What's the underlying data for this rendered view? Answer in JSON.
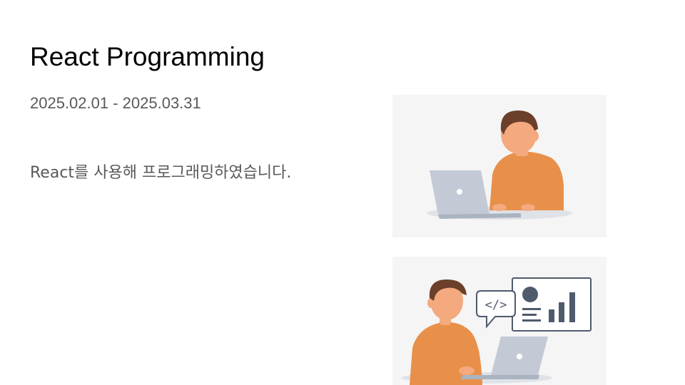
{
  "slide": {
    "title": "React Programming",
    "date_range": "2025.02.01 - 2025.03.31",
    "description": "React를 사용해 프로그래밍하였습니다."
  },
  "colors": {
    "title": "#000000",
    "body_text": "#595959",
    "illustration_bg": "#f5f5f5",
    "shirt": "#e8904a",
    "skin": "#f4a97f",
    "hair": "#6b3f2a",
    "laptop": "#c3cad6"
  },
  "illustrations": [
    {
      "name": "person-with-laptop"
    },
    {
      "name": "developer-with-code-and-chart-icons"
    }
  ]
}
